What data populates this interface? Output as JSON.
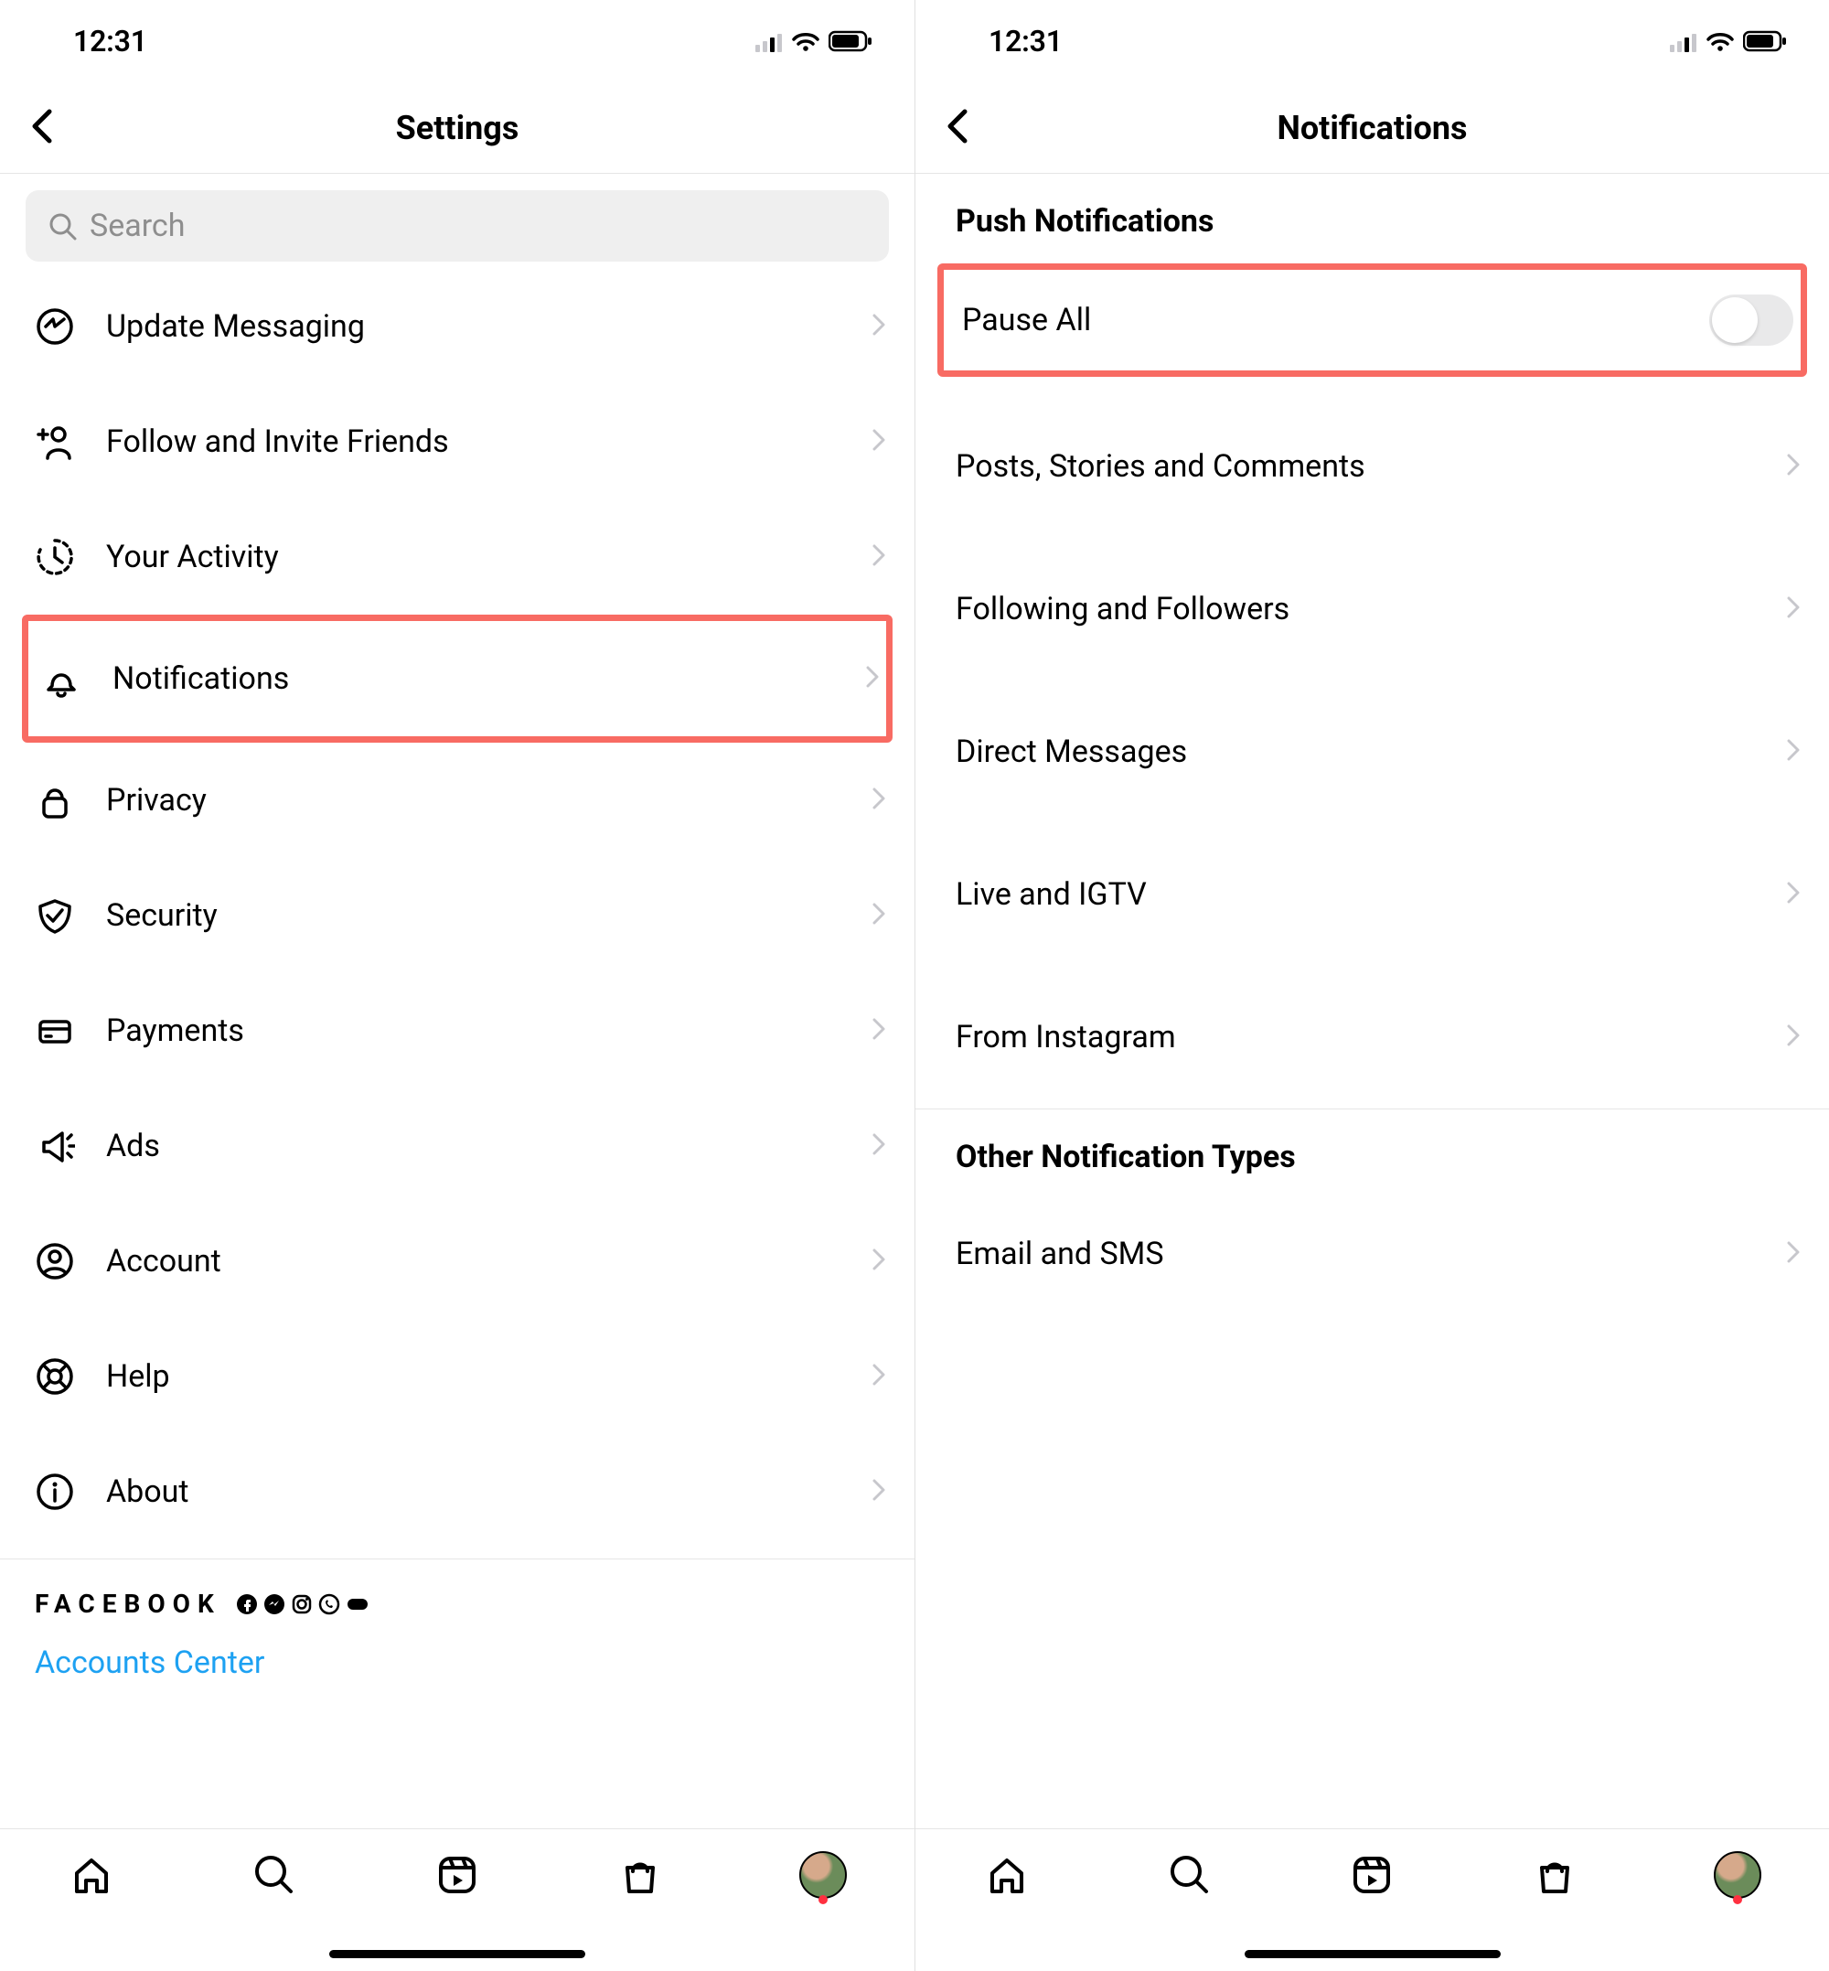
{
  "statusbar": {
    "time": "12:31"
  },
  "settings": {
    "title": "Settings",
    "search_placeholder": "Search",
    "items": [
      {
        "label": "Update Messaging"
      },
      {
        "label": "Follow and Invite Friends"
      },
      {
        "label": "Your Activity"
      },
      {
        "label": "Notifications"
      },
      {
        "label": "Privacy"
      },
      {
        "label": "Security"
      },
      {
        "label": "Payments"
      },
      {
        "label": "Ads"
      },
      {
        "label": "Account"
      },
      {
        "label": "Help"
      },
      {
        "label": "About"
      }
    ],
    "brand": "FACEBOOK",
    "accounts_center": "Accounts Center"
  },
  "notifications": {
    "title": "Notifications",
    "push_section": "Push Notifications",
    "pause_all": "Pause All",
    "pause_all_on": false,
    "items": [
      {
        "label": "Posts, Stories and Comments"
      },
      {
        "label": "Following and Followers"
      },
      {
        "label": "Direct Messages"
      },
      {
        "label": "Live and IGTV"
      },
      {
        "label": "From Instagram"
      }
    ],
    "other_section": "Other Notification Types",
    "other_items": [
      {
        "label": "Email and SMS"
      }
    ]
  }
}
